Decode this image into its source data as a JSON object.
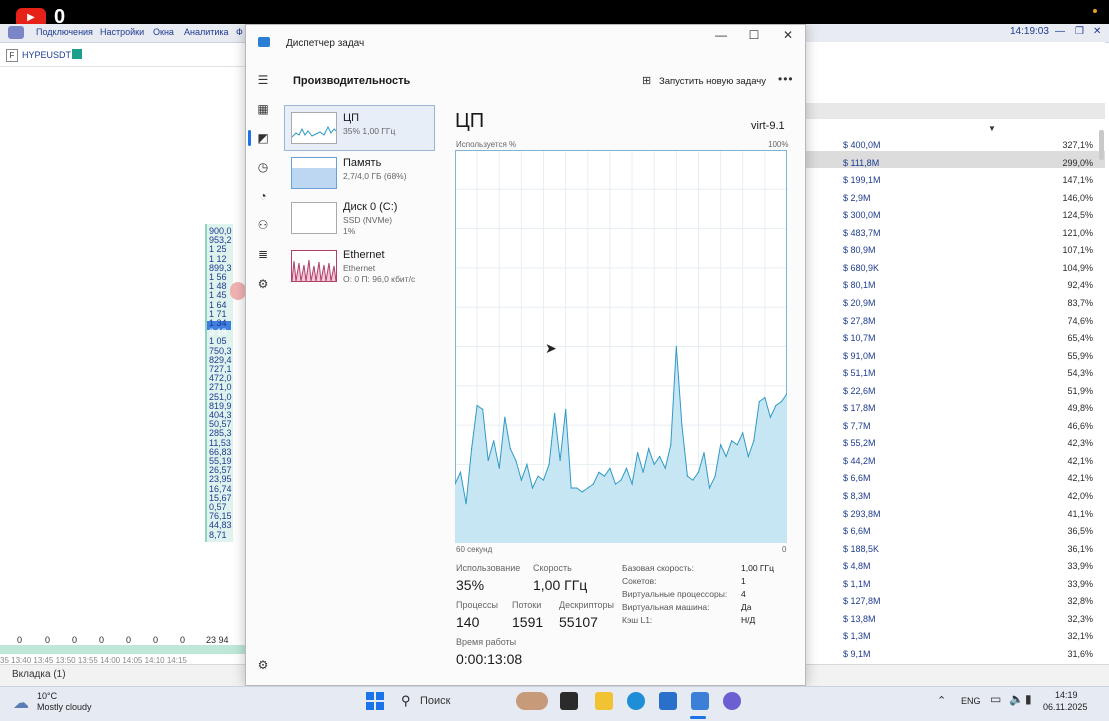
{
  "top_strip": {
    "badge_count": "0"
  },
  "background_app": {
    "menu": [
      "Подключения",
      "Настройки",
      "Окна",
      "Аналитика",
      "Ф"
    ],
    "clock": "14:19:03",
    "ticker": {
      "letter": "F",
      "symbol": "HYPEUSDT"
    },
    "ladder_prices": [
      "900,0",
      "953,2",
      "1 25",
      "1 12",
      "899,3",
      "1 56",
      "1 48",
      "1 45",
      "1 64",
      "1 71",
      "1 34",
      "3 18",
      "1 05",
      "750,3",
      "829,4",
      "727,1",
      "472,0",
      "271,0",
      "251,0",
      "819,9",
      "404,3",
      "50,57",
      "285,3",
      "11,53",
      "66,83",
      "55,19",
      "26,57",
      "23,95",
      "16,74",
      "15,67",
      "0,57",
      "76,15",
      "44,83",
      "8,71"
    ],
    "bottom_zeros": [
      "0",
      "0",
      "0",
      "0",
      "0",
      "0",
      "0",
      "23 94"
    ],
    "time_axis": "35 13:40 13:45 13:50 13:55 14:00 14:05 14:10 14:15",
    "tab": "Вкладка (1)",
    "table_rows": [
      {
        "vol": "$ 400,0M",
        "pct": "327,1%"
      },
      {
        "vol": "$ 111,8M",
        "pct": "299,0%"
      },
      {
        "vol": "$ 199,1M",
        "pct": "147,1%"
      },
      {
        "vol": "$ 2,9M",
        "pct": "146,0%"
      },
      {
        "vol": "$ 300,0M",
        "pct": "124,5%"
      },
      {
        "vol": "$ 483,7M",
        "pct": "121,0%"
      },
      {
        "vol": "$ 80,9M",
        "pct": "107,1%"
      },
      {
        "vol": "$ 680,9K",
        "pct": "104,9%"
      },
      {
        "vol": "$ 80,1M",
        "pct": "92,4%"
      },
      {
        "vol": "$ 20,9M",
        "pct": "83,7%"
      },
      {
        "vol": "$ 27,8M",
        "pct": "74,6%"
      },
      {
        "vol": "$ 10,7M",
        "pct": "65,4%"
      },
      {
        "vol": "$ 91,0M",
        "pct": "55,9%"
      },
      {
        "vol": "$ 51,1M",
        "pct": "54,3%"
      },
      {
        "vol": "$ 22,6M",
        "pct": "51,9%"
      },
      {
        "vol": "$ 17,8M",
        "pct": "49,8%"
      },
      {
        "vol": "$ 7,7M",
        "pct": "46,6%"
      },
      {
        "vol": "$ 55,2M",
        "pct": "42,3%"
      },
      {
        "vol": "$ 44,2M",
        "pct": "42,1%"
      },
      {
        "vol": "$ 6,6M",
        "pct": "42,1%"
      },
      {
        "vol": "$ 8,3M",
        "pct": "42,0%"
      },
      {
        "vol": "$ 293,8M",
        "pct": "41,1%"
      },
      {
        "vol": "$ 6,6M",
        "pct": "36,5%"
      },
      {
        "vol": "$ 188,5K",
        "pct": "36,1%"
      },
      {
        "vol": "$ 4,8M",
        "pct": "33,9%"
      },
      {
        "vol": "$ 1,1M",
        "pct": "33,9%"
      },
      {
        "vol": "$ 127,8M",
        "pct": "32,8%"
      },
      {
        "vol": "$ 13,8M",
        "pct": "32,3%"
      },
      {
        "vol": "$ 1,3M",
        "pct": "32,1%"
      },
      {
        "vol": "$ 9,1M",
        "pct": "31,6%"
      }
    ]
  },
  "task_manager": {
    "title": "Диспетчер задач",
    "section": "Производительность",
    "run_task": "Запустить новую задачу",
    "resources": [
      {
        "name": "ЦП",
        "sub1": "35% 1,00 ГГц",
        "sub2": ""
      },
      {
        "name": "Память",
        "sub1": "2,7/4,0 ГБ (68%)",
        "sub2": ""
      },
      {
        "name": "Диск 0 (C:)",
        "sub1": "SSD (NVMe)",
        "sub2": "1%"
      },
      {
        "name": "Ethernet",
        "sub1": "Ethernet",
        "sub2": "О: 0 П: 96,0 кбит/с"
      }
    ],
    "cpu": {
      "title": "ЦП",
      "model": "virt-9.1",
      "usage_axis": "Используется %",
      "max_axis": "100%",
      "x_left": "60 секунд",
      "x_right": "0",
      "stats": {
        "usage_label": "Использование",
        "usage": "35%",
        "speed_label": "Скорость",
        "speed": "1,00 ГГц",
        "procs_label": "Процессы",
        "procs": "140",
        "threads_label": "Потоки",
        "threads": "1591",
        "handles_label": "Дескрипторы",
        "handles": "55107",
        "uptime_label": "Время работы",
        "uptime": "0:00:13:08"
      },
      "specs": [
        {
          "k": "Базовая скорость:",
          "v": "1,00 ГГц"
        },
        {
          "k": "Сокетов:",
          "v": "1"
        },
        {
          "k": "Виртуальные процессоры:",
          "v": "4"
        },
        {
          "k": "Виртуальная машина:",
          "v": "Да"
        },
        {
          "k": "Кэш L1:",
          "v": "Н/Д"
        }
      ]
    }
  },
  "chart_data": {
    "type": "area",
    "x": [
      60,
      59,
      58,
      57,
      56,
      55,
      54,
      53,
      52,
      51,
      50,
      49,
      48,
      47,
      46,
      45,
      44,
      43,
      42,
      41,
      40,
      39,
      38,
      37,
      36,
      35,
      34,
      33,
      32,
      31,
      30,
      29,
      28,
      27,
      26,
      25,
      24,
      23,
      22,
      21,
      20,
      19,
      18,
      17,
      16,
      15,
      14,
      13,
      12,
      11,
      10,
      9,
      8,
      7,
      6,
      5,
      4,
      3,
      2,
      1,
      0
    ],
    "series": [
      {
        "values": [
          15,
          18,
          10,
          24,
          35,
          34,
          21,
          26,
          19,
          32,
          24,
          21,
          16,
          20,
          14,
          17,
          16,
          20,
          33,
          21,
          34,
          14,
          14,
          13,
          14,
          15,
          18,
          17,
          19,
          15,
          16,
          19,
          15,
          23,
          18,
          24,
          20,
          22,
          19,
          25,
          50,
          30,
          17,
          16,
          18,
          23,
          14,
          17,
          25,
          22,
          26,
          25,
          28,
          22,
          26,
          36,
          37,
          32,
          35,
          36,
          38
        ]
      }
    ],
    "ylim": [
      0,
      100
    ],
    "grid": true,
    "colors": {
      "fill": "#c7e6f4",
      "stroke": "#2e9ac4",
      "grid": "#e6eef3"
    }
  },
  "taskbar": {
    "weather_temp": "10°C",
    "weather_desc": "Mostly cloudy",
    "search": "Поиск",
    "lang": "ENG",
    "time": "14:19",
    "date": "06.11.2025"
  }
}
